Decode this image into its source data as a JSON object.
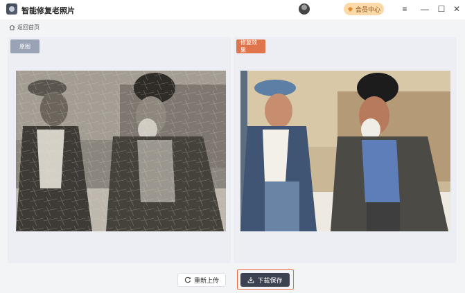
{
  "app": {
    "title": "智能修复老照片"
  },
  "header": {
    "vip_label": "会员中心",
    "minimize_glyph": "—",
    "maximize_glyph": "☐",
    "close_glyph": "✕",
    "menu_glyph": "≡"
  },
  "nav": {
    "back_label": "返回首页"
  },
  "panels": {
    "original_label": "原图",
    "restored_label": "修复效果"
  },
  "actions": {
    "reupload_label": "重新上传",
    "download_label": "下载保存"
  },
  "colors": {
    "accent": "#e0744a",
    "download_button": "#3c4250",
    "vip_badge": "#fcd9a8"
  }
}
